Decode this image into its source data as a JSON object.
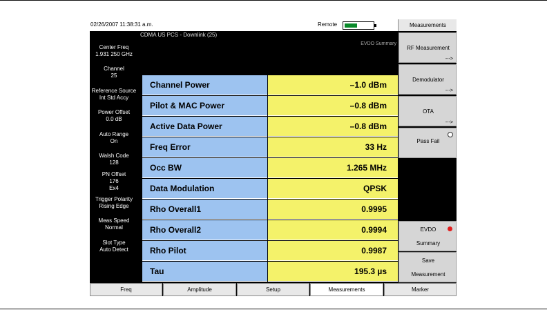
{
  "status": {
    "timestamp": "02/26/2007 11:38:31 a.m.",
    "remote_label": "Remote",
    "menu_header": "Measurements"
  },
  "main": {
    "subtitle": "CDMA US PCS - Downlink (25)",
    "summary_label": "EVDO Summary"
  },
  "left_panel": {
    "center_freq": {
      "label": "Center Freq",
      "value": "1.931 250 GHz"
    },
    "channel": {
      "label": "Channel",
      "value": "25"
    },
    "reference_source": {
      "label": "Reference Source",
      "value": "Int Std Accy"
    },
    "power_offset": {
      "label": "Power Offset",
      "value": "0.0 dB"
    },
    "auto_range": {
      "label": "Auto Range",
      "value": "On"
    },
    "walsh_code": {
      "label": "Walsh Code",
      "value": "128"
    },
    "pn_offset": {
      "label": "PN Offset",
      "value": "176",
      "extra": "Ex4"
    },
    "trigger_polarity": {
      "label": "Trigger Polarity",
      "value": "Rising Edge"
    },
    "meas_speed": {
      "label": "Meas Speed",
      "value": "Normal"
    },
    "slot_type": {
      "label": "Slot Type",
      "value": "Auto Detect"
    }
  },
  "table": {
    "rows": [
      {
        "label": "Channel Power",
        "value": "–1.0 dBm"
      },
      {
        "label": "Pilot & MAC Power",
        "value": "–0.8 dBm"
      },
      {
        "label": "Active Data Power",
        "value": "–0.8 dBm"
      },
      {
        "label": "Freq Error",
        "value": "33 Hz"
      },
      {
        "label": "Occ BW",
        "value": "1.265 MHz"
      },
      {
        "label": "Data Modulation",
        "value": "QPSK"
      },
      {
        "label": "Rho Overall1",
        "value": "0.9995"
      },
      {
        "label": "Rho Overall2",
        "value": "0.9994"
      },
      {
        "label": "Rho Pilot",
        "value": "0.9987"
      },
      {
        "label": "Tau",
        "value": "195.3 µs"
      }
    ]
  },
  "softkeys": {
    "rf_measurement": "RF Measurement",
    "demodulator": "Demodulator",
    "ota": "OTA",
    "pass_fail": "Pass Fail",
    "evdo_summary_line1": "EVDO",
    "evdo_summary_line2": "Summary",
    "save_line1": "Save",
    "save_line2": "Measurement",
    "submenu_arrow": "--->"
  },
  "tabs": [
    "Freq",
    "Amplitude",
    "Setup",
    "Measurements",
    "Marker"
  ],
  "colors": {
    "label_cell": "#9dc3f0",
    "value_cell": "#f4f26a",
    "battery": "#0a8a2a",
    "active_dot": "#e21d1d"
  }
}
